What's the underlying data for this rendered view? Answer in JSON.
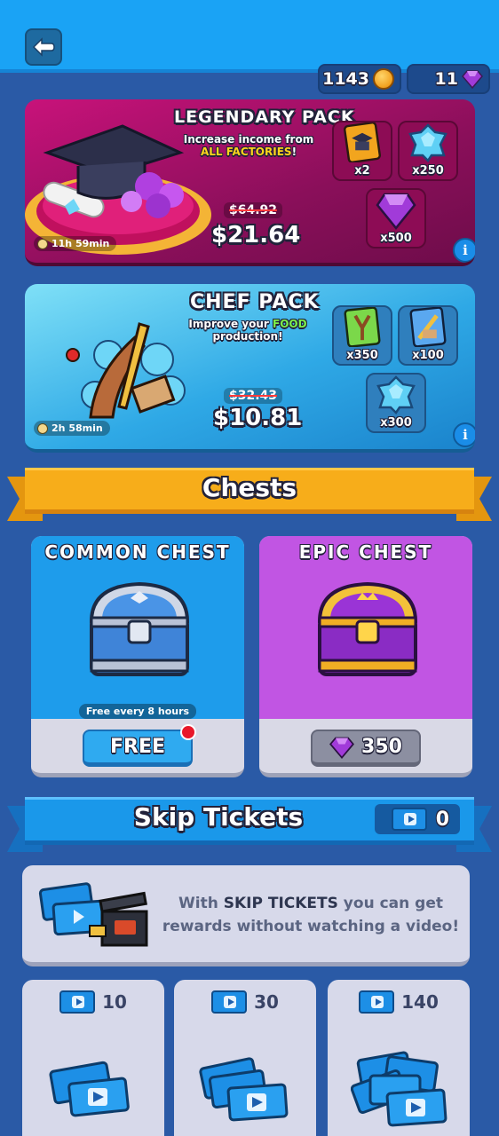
{
  "header": {
    "coins": "1143",
    "gems": "11"
  },
  "legendary_pack": {
    "title": "LEGENDARY PACK",
    "desc_line1": "Increase income from",
    "desc_highlight": "ALL FACTORIES",
    "desc_end": "!",
    "old_price": "$64.92",
    "price": "$21.64",
    "timer": "11h 59min",
    "items": [
      {
        "icon": "hat-card-icon",
        "qty": "x2"
      },
      {
        "icon": "blue-crystal-icon",
        "qty": "x250"
      },
      {
        "icon": "purple-gem-icon",
        "qty": "x500"
      }
    ],
    "colors": {
      "bg": "#c8127a",
      "highlight": "#ffd41c"
    }
  },
  "chef_pack": {
    "title": "CHEF PACK",
    "desc_prefix": "Improve your ",
    "desc_highlight": "FOOD",
    "desc_line2": "production!",
    "old_price": "$32.43",
    "price": "$10.81",
    "timer": "2h 58min",
    "items": [
      {
        "icon": "slingshot-card-icon",
        "qty": "x350"
      },
      {
        "icon": "knife-card-icon",
        "qty": "x100"
      },
      {
        "icon": "blue-crystal-icon",
        "qty": "x300"
      }
    ],
    "colors": {
      "bg": "#2fa9e6",
      "highlight": "#7df04a"
    }
  },
  "chests_section": {
    "title": "Chests",
    "common": {
      "title": "COMMON CHEST",
      "note": "Free every 8 hours",
      "button": "FREE"
    },
    "epic": {
      "title": "EPIC CHEST",
      "button": "350"
    }
  },
  "skip_section": {
    "title": "Skip Tickets",
    "count": "0",
    "info_prefix": "With ",
    "info_bold": "SKIP TICKETS",
    "info_suffix": " you can get rewards without watching a video!",
    "offers": [
      {
        "amount": "10"
      },
      {
        "amount": "30"
      },
      {
        "amount": "140"
      }
    ]
  }
}
